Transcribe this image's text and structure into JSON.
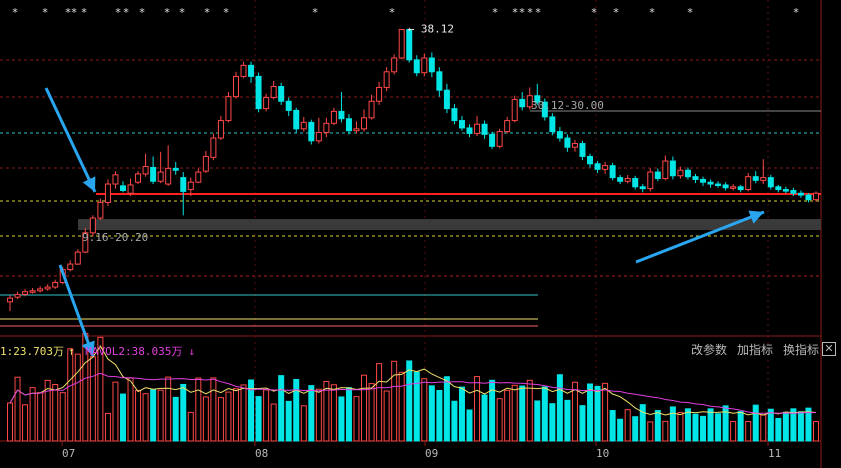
{
  "chart_data": {
    "type": "candlestick",
    "price_labels": {
      "high_marker": "38.12",
      "band_upper": "30.12-30.00",
      "band_lower": "9.16-20.20"
    },
    "volume_legend": {
      "ma1_label": "1:23.703万",
      "ma2_label": "MAVOL2:38.035万"
    },
    "x_ticks": [
      "07",
      "08",
      "09",
      "10",
      "11"
    ],
    "colors": {
      "up": "#ff4848",
      "down": "#00e5e5",
      "support_line": "#ff2020",
      "ma1": "#f0e26a",
      "ma2": "#e040e0",
      "arrow": "#2aa6f0"
    }
  },
  "toolbar": {
    "params": "改参数",
    "add": "加指标",
    "switch": "换指标",
    "close": "✕"
  }
}
